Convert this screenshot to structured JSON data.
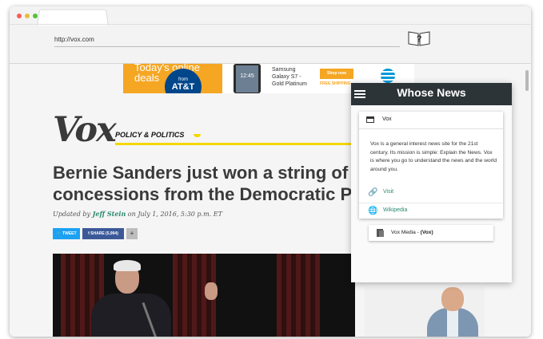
{
  "browser": {
    "url": "http://vox.com",
    "tab_title": "",
    "traffic_lights": [
      "#fc5b57",
      "#e5bf3c",
      "#57c038"
    ],
    "extension_icon": "question-book-icon"
  },
  "ad": {
    "deals_text": "Today's online deals",
    "brand_from": "from",
    "brand": "AT&T",
    "phone_time": "12:45",
    "product_line1": "Samsung",
    "product_line2": "Galaxy S7 -",
    "product_line3": "Gold Platinum",
    "shop_now": "Shop now",
    "free_shipping": "FREE SHIPPING",
    "accent_color": "#f5a623"
  },
  "article": {
    "site_logo": "Vox",
    "section": "POLICY & POLITICS",
    "headline_line1": "Bernie Sanders just won a string of",
    "headline_line2": "concessions from the Democratic Pa",
    "byline_prefix": "Updated by ",
    "author": "Jeff Stein",
    "byline_date": " on July 1, 2016, 5:30 p.m. ET",
    "share_tweet": "TWEET",
    "share_facebook": "SHARE (5,994)",
    "share_more": "+"
  },
  "popup": {
    "title": "Whose News",
    "source_name": "Vox",
    "description": "Vox is a general interest news site for the 21st century. Its mission is simple: Explain the News. Vox is where you go to understand the news and the world around you.",
    "links": [
      {
        "label": "Visit",
        "icon": "link-icon"
      },
      {
        "label": "Wikipedia",
        "icon": "globe-icon"
      }
    ],
    "owner_name": "Vox Media - ",
    "owner_bold": "(Vox)",
    "header_color": "#2d3438",
    "link_color": "#2b8a6e"
  }
}
